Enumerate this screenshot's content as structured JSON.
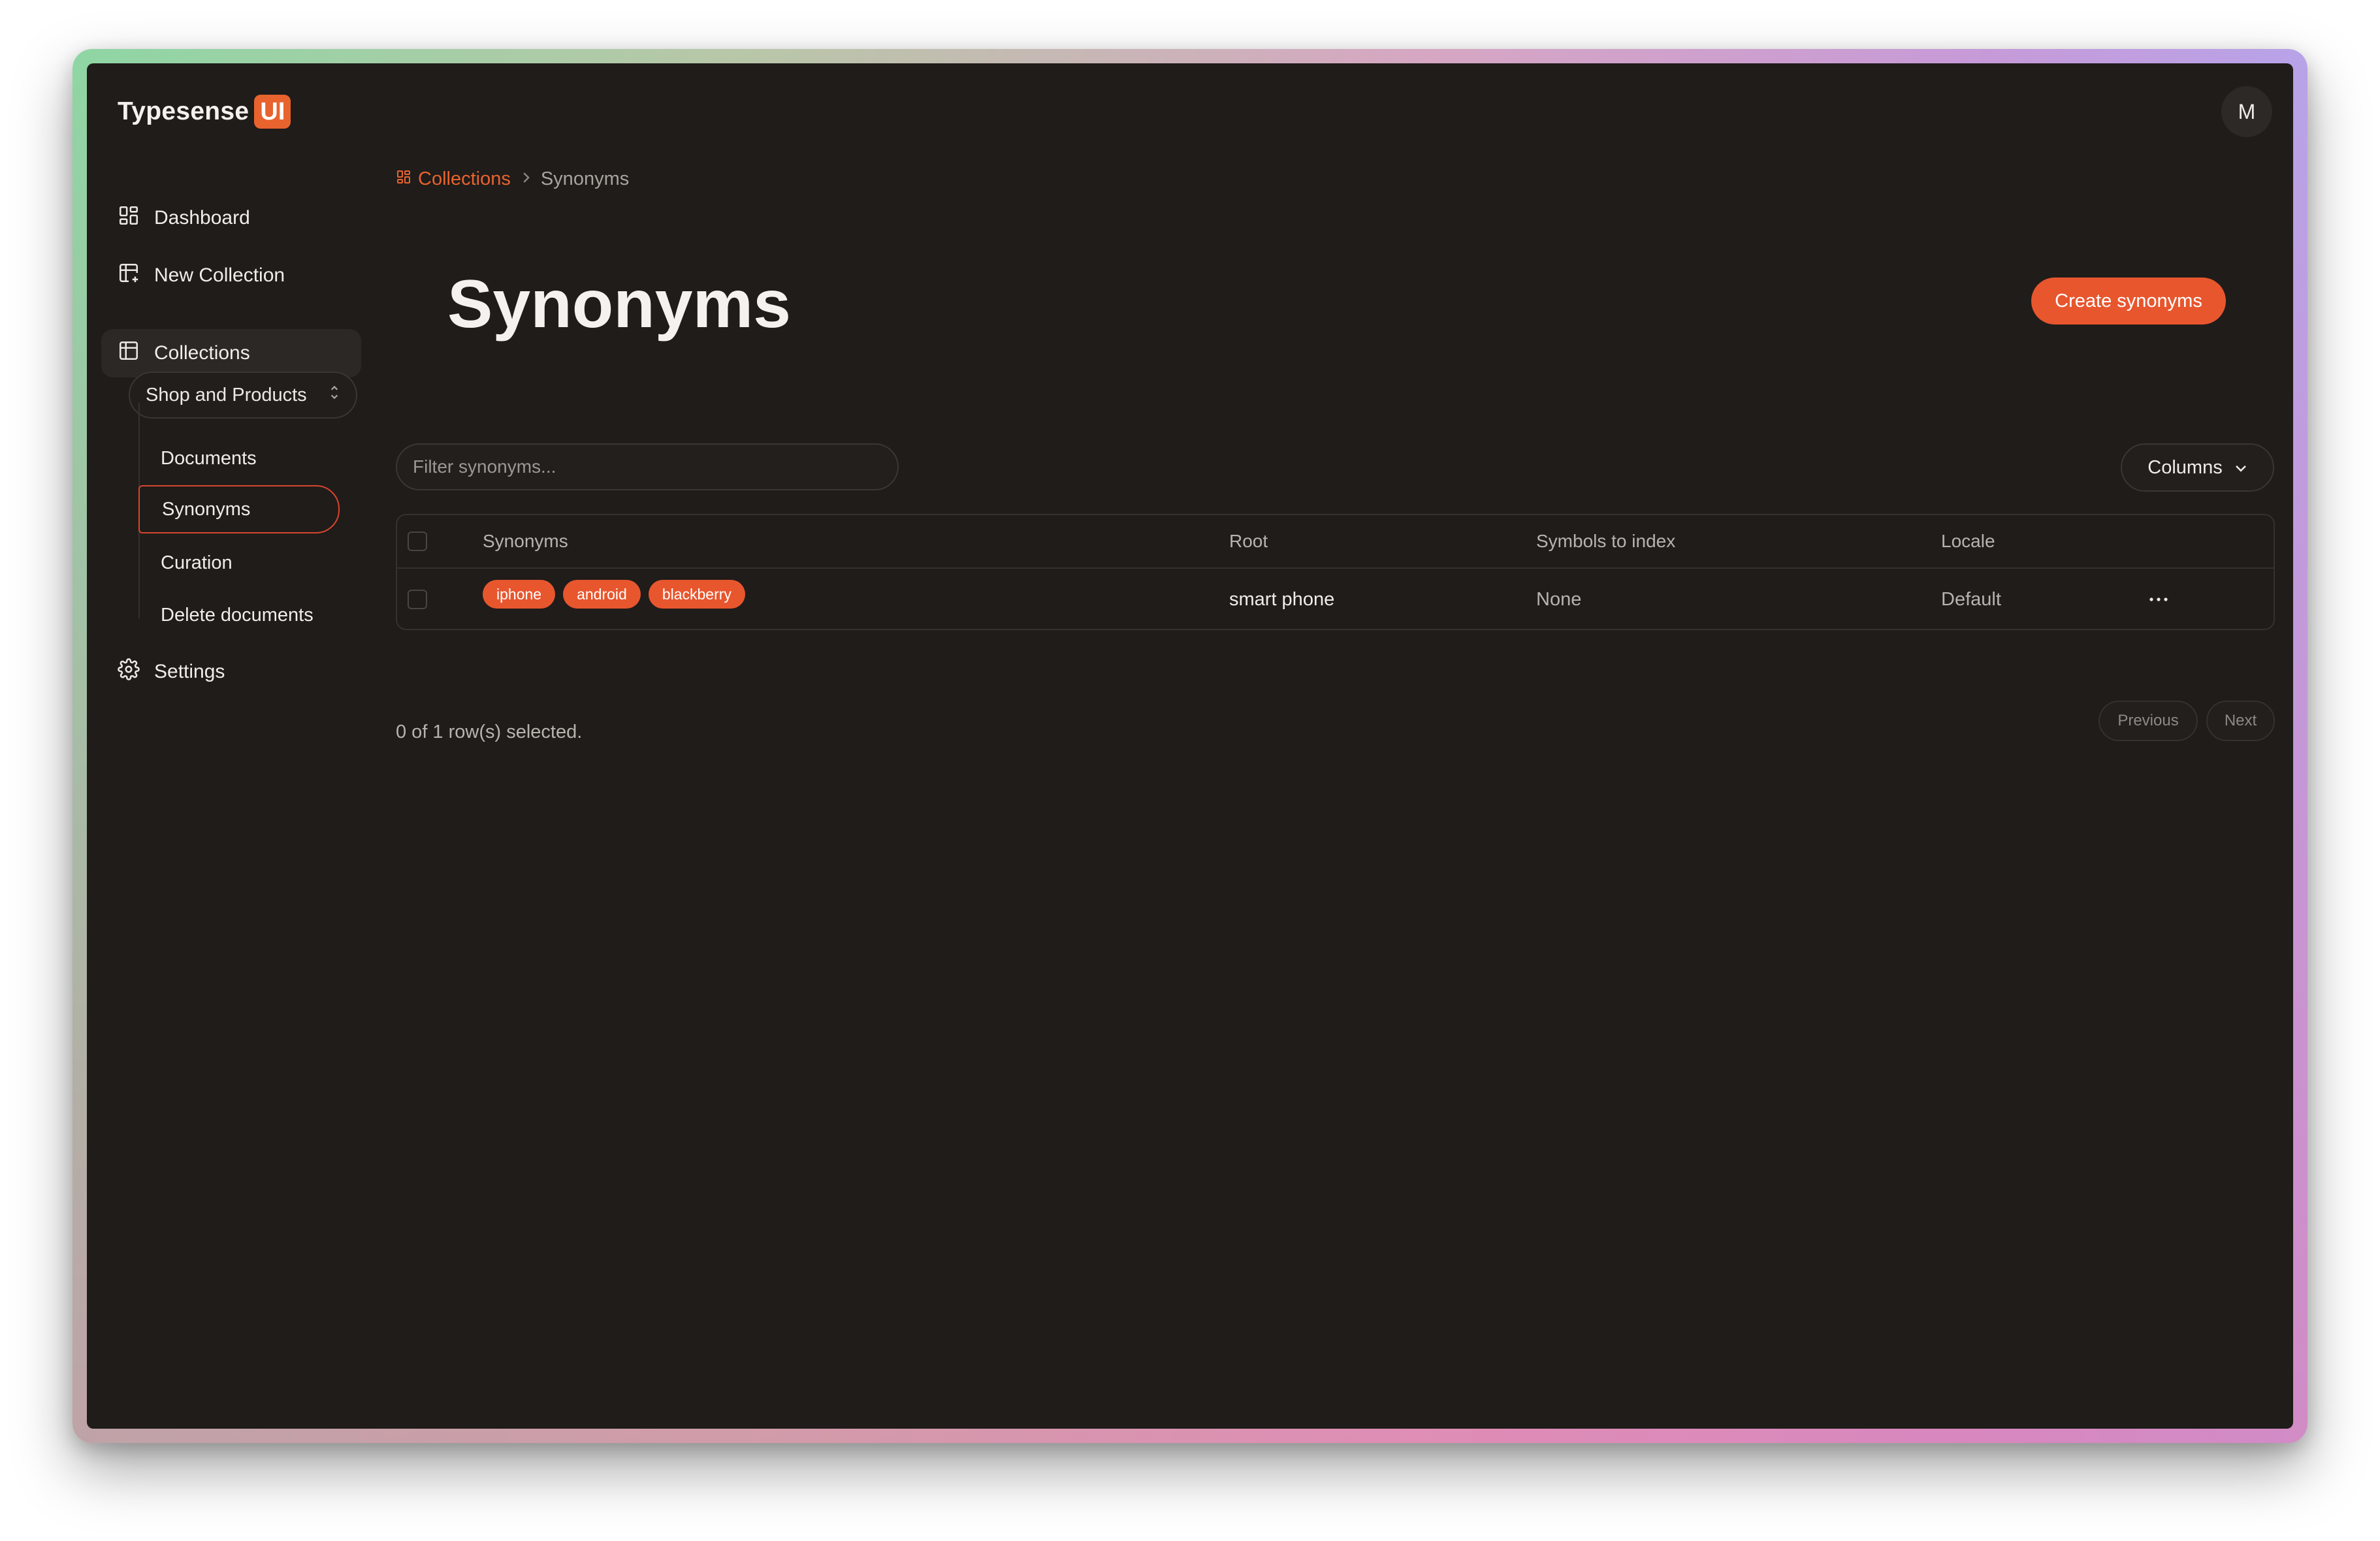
{
  "app": {
    "logo_text": "Typesense",
    "logo_badge": "UI",
    "avatar_initial": "M"
  },
  "sidebar": {
    "items": [
      {
        "label": "Dashboard",
        "icon": "dashboard-icon"
      },
      {
        "label": "New Collection",
        "icon": "table-plus-icon"
      },
      {
        "label": "Collections",
        "icon": "table-icon"
      },
      {
        "label": "Settings",
        "icon": "gear-icon"
      }
    ],
    "collection_select": "Shop and Products",
    "sub_items": [
      "Documents",
      "Synonyms",
      "Curation",
      "Delete documents"
    ]
  },
  "breadcrumb": {
    "parent": "Collections",
    "current": "Synonyms"
  },
  "page": {
    "title": "Synonyms",
    "create_button": "Create synonyms"
  },
  "filter": {
    "placeholder": "Filter synonyms..."
  },
  "columns_button": "Columns",
  "table": {
    "headers": [
      "Synonyms",
      "Root",
      "Symbols to index",
      "Locale"
    ],
    "rows": [
      {
        "synonyms": [
          "iphone",
          "android",
          "blackberry"
        ],
        "root": "smart phone",
        "symbols": "None",
        "locale": "Default"
      }
    ]
  },
  "footer": {
    "selected": "0 of 1 row(s) selected.",
    "previous": "Previous",
    "next": "Next"
  },
  "colors": {
    "accent": "#e8562e",
    "background": "#1f1c1a"
  }
}
